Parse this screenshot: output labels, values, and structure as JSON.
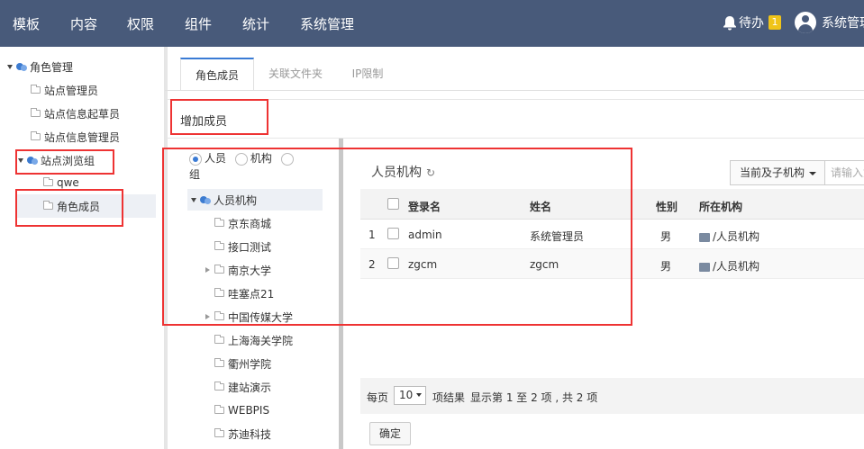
{
  "topbar": {
    "nav": [
      "模板",
      "内容",
      "权限",
      "组件",
      "统计",
      "系统管理"
    ],
    "todo_label": "待办",
    "todo_count": "1",
    "user_label": "系统管理"
  },
  "sidebar": {
    "root": "角色管理",
    "items": [
      "站点管理员",
      "站点信息起草员",
      "站点信息管理员"
    ],
    "browse_group": "站点浏览组",
    "children": [
      "qwe",
      "角色成员"
    ]
  },
  "tabs": [
    "角色成员",
    "关联文件夹",
    "IP限制"
  ],
  "panel_title": "增加成员",
  "org_tree": {
    "radio_person": "人员",
    "radio_org": "机构",
    "radio_group": "组",
    "root": "人员机构",
    "nodes": [
      "京东商城",
      "接口测试",
      "南京大学",
      "哇塞点21",
      "中国传媒大学",
      "上海海关学院",
      "衢州学院",
      "建站演示",
      "WEBPIS",
      "苏迪科技"
    ]
  },
  "grid": {
    "title": "人员机构",
    "scope": "当前及子机构",
    "search_placeholder": "请输入如",
    "columns": [
      "登录名",
      "姓名",
      "性别",
      "所在机构"
    ],
    "rows": [
      {
        "num": "1",
        "login": "admin",
        "name": "系统管理员",
        "gender": "男",
        "org": "/人员机构"
      },
      {
        "num": "2",
        "login": "zgcm",
        "name": "zgcm",
        "gender": "男",
        "org": "/人员机构"
      }
    ]
  },
  "pager": {
    "per_page_label": "每页",
    "per_page": "10",
    "result_label": "项结果",
    "summary": "显示第 1 至 2 项 , 共 2 项"
  },
  "confirm_label": "确定",
  "colors": {
    "topbar": "#485a7a",
    "accent": "#3a7bd5",
    "highlight_box": "#e33333"
  }
}
